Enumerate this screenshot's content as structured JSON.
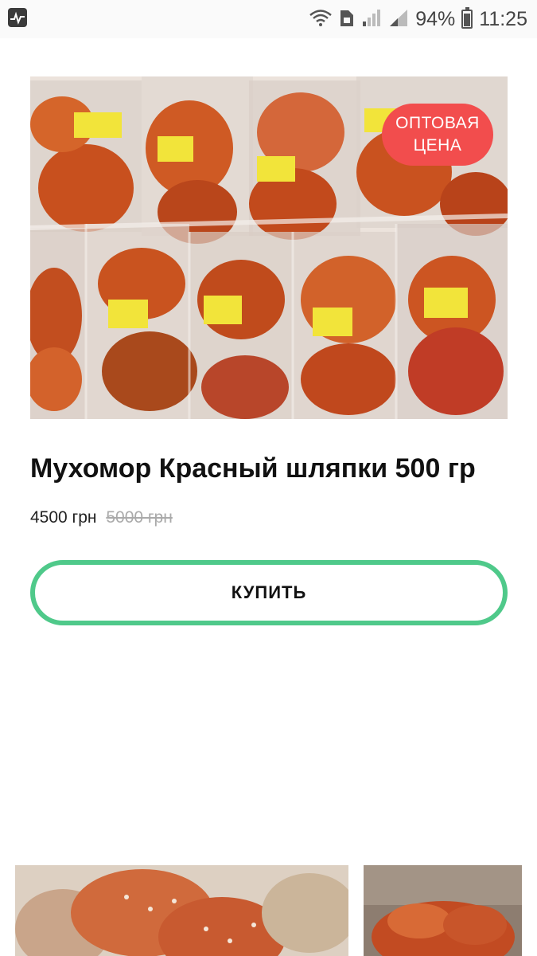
{
  "status_bar": {
    "battery": "94%",
    "time": "11:25"
  },
  "product": {
    "badge": "ОПТОВАЯ ЦЕНА",
    "title": "Мухомор Красный шляпки 500 гр",
    "price": "4500 грн",
    "old_price": "5000 грн",
    "buy_label": "КУПИТЬ"
  },
  "colors": {
    "badge": "#f24d4d",
    "button_border": "#4fc98a"
  }
}
